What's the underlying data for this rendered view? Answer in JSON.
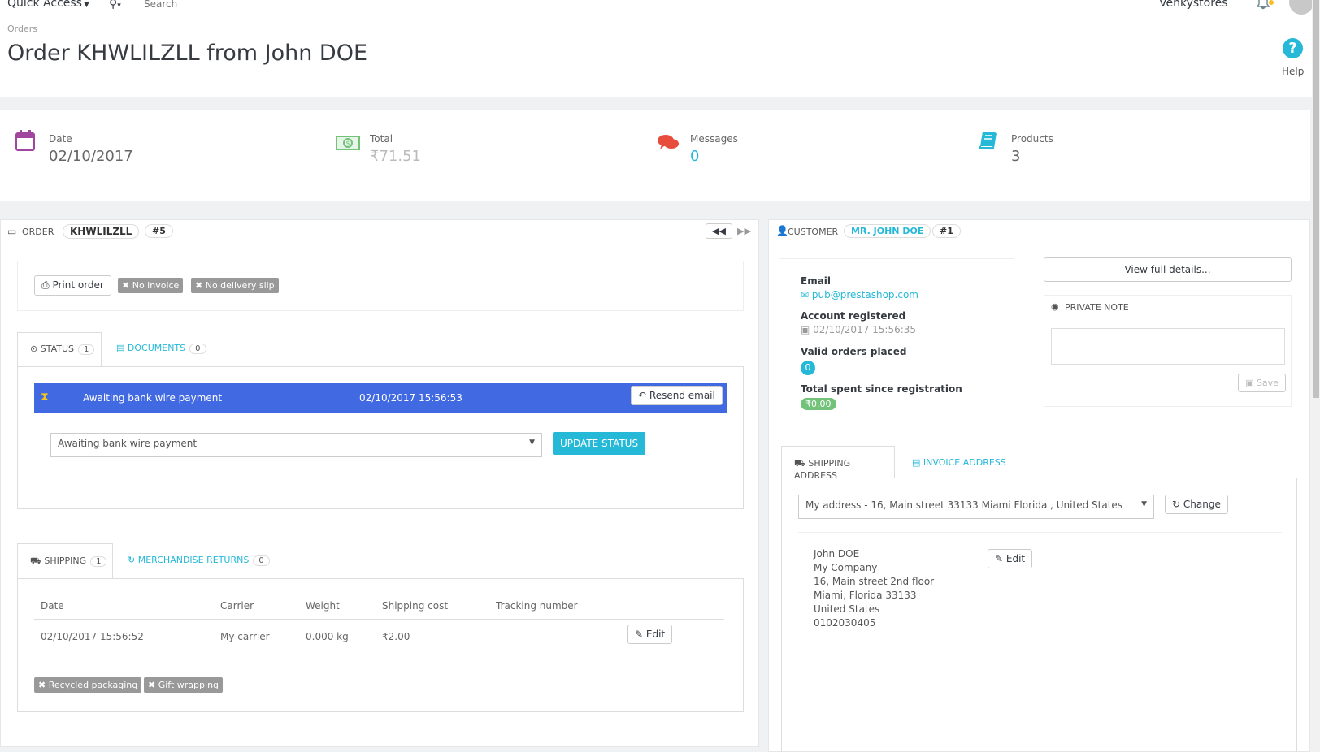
{
  "header": {
    "quick_access": "Quick Access",
    "search_placeholder": "Search",
    "shop_name": "Venkystores",
    "breadcrumb": "Orders",
    "title": "Order KHWLILZLL from John DOE",
    "help": "Help"
  },
  "kpis": [
    {
      "label": "Date",
      "value": "02/10/2017"
    },
    {
      "label": "Total",
      "value": "₹71.51"
    },
    {
      "label": "Messages",
      "value": "0"
    },
    {
      "label": "Products",
      "value": "3"
    }
  ],
  "order_panel": {
    "heading": "ORDER",
    "reference": "KHWLILZLL",
    "id": "#5",
    "print_order": "Print order",
    "no_invoice": "No invoice",
    "no_delivery_slip": "No delivery slip",
    "tabs": [
      {
        "label": "STATUS",
        "count": "1"
      },
      {
        "label": "DOCUMENTS",
        "count": "0"
      }
    ],
    "status_row": {
      "status": "Awaiting bank wire payment",
      "date": "02/10/2017 15:56:53",
      "resend": "Resend email"
    },
    "status_select": "Awaiting bank wire payment",
    "update_status": "UPDATE STATUS",
    "shipping_tabs": [
      {
        "label": "SHIPPING",
        "count": "1"
      },
      {
        "label": "MERCHANDISE RETURNS",
        "count": "0"
      }
    ],
    "shipping_table": {
      "headers": [
        "Date",
        "Carrier",
        "Weight",
        "Shipping cost",
        "Tracking number"
      ],
      "row": {
        "date": "02/10/2017 15:56:52",
        "carrier": "My carrier",
        "weight": "0.000 kg",
        "cost": "₹2.00",
        "tracking": "",
        "edit": "Edit"
      }
    },
    "recycled": "Recycled packaging",
    "gift": "Gift wrapping"
  },
  "customer_panel": {
    "heading": "CUSTOMER",
    "name": "MR. JOHN DOE",
    "id": "#1",
    "email_label": "Email",
    "email": "pub@prestashop.com",
    "registered_label": "Account registered",
    "registered": "02/10/2017 15:56:35",
    "valid_orders_label": "Valid orders placed",
    "valid_orders": "0",
    "total_spent_label": "Total spent since registration",
    "total_spent": "₹0.00",
    "view_details": "View full details...",
    "private_note": "PRIVATE NOTE",
    "save": "Save",
    "address_tabs": [
      "SHIPPING ADDRESS",
      "INVOICE ADDRESS"
    ],
    "address_select": "My address - 16, Main street 33133 Miami Florida , United States",
    "change": "Change",
    "address_lines": [
      "John DOE",
      "My Company",
      "16, Main street 2nd floor",
      "Miami, Florida 33133",
      "United States",
      "0102030405"
    ],
    "edit": "Edit"
  },
  "colors": {
    "accent": "#25b9d7",
    "status_bar": "#4169e1",
    "success": "#72c279",
    "danger": "#e84c3d"
  }
}
